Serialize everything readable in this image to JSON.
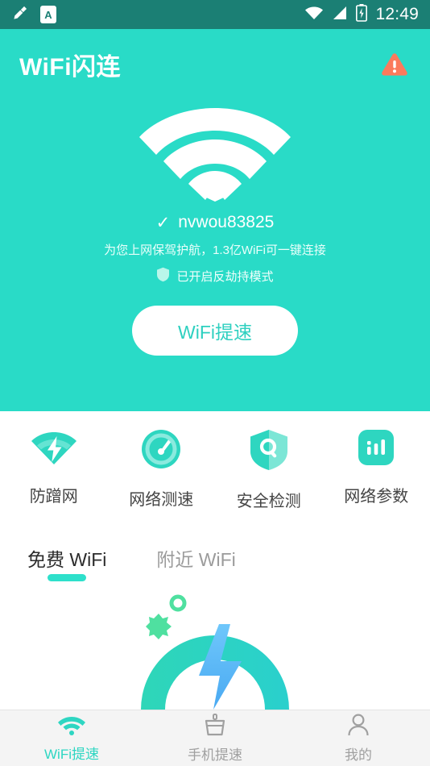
{
  "status_bar": {
    "icons_left": [
      "broom-icon",
      "letter-a-badge-icon"
    ],
    "a_badge_text": "A",
    "icons_right": [
      "wifi-icon",
      "signal-icon",
      "battery-icon"
    ],
    "time": "12:49",
    "background": "#1b7f74"
  },
  "hero": {
    "app_title": "WiFi闪连",
    "warning_icon": "warning-triangle-icon",
    "warning_color": "#fb7a5c",
    "wifi_icon": "wifi-large-icon",
    "check_mark": "✓",
    "ssid": "nvwou83825",
    "tagline": "为您上网保驾护航，1.3亿WiFi可一键连接",
    "mode_icon": "shield-icon",
    "mode_text": "已开启反劫持模式",
    "boost_button": "WiFi提速",
    "background": "#29dbc7"
  },
  "features": [
    {
      "icon": "wifi-bolt-icon",
      "label": "防蹭网"
    },
    {
      "icon": "speedometer-icon",
      "label": "网络测速"
    },
    {
      "icon": "shield-search-icon",
      "label": "安全检测"
    },
    {
      "icon": "bar-chart-icon",
      "label": "网络参数"
    }
  ],
  "tabs": [
    {
      "label": "免费 WiFi",
      "active": true
    },
    {
      "label": "附近 WiFi",
      "active": false
    }
  ],
  "illustration": {
    "name": "speed-boost-illustration",
    "arc_color": "#2ed6c0",
    "bolt_color": "#4fb5f5",
    "decoration_color": "#4fe0a0"
  },
  "bottom_nav": [
    {
      "icon": "wifi-icon",
      "label": "WiFi提速",
      "active": true
    },
    {
      "icon": "broom-icon",
      "label": "手机提速",
      "active": false
    },
    {
      "icon": "person-icon",
      "label": "我的",
      "active": false
    }
  ],
  "accent_color": "#2ed6c2"
}
